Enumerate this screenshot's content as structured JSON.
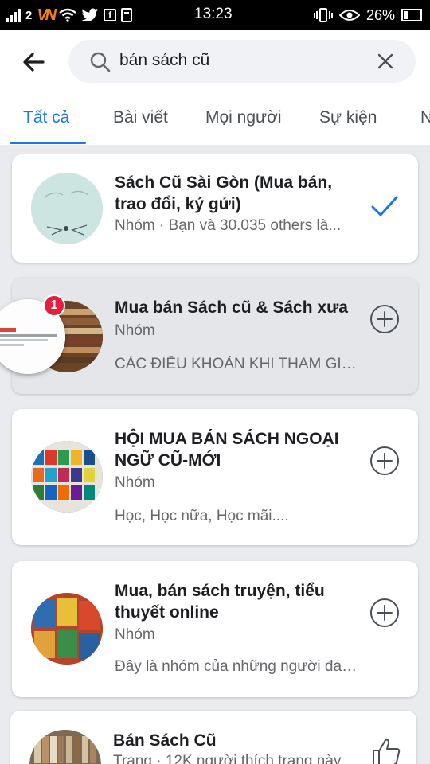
{
  "status_bar": {
    "carrier": "VN",
    "net_type": "2",
    "time": "13:23",
    "battery": "26%",
    "icons": [
      "signal-icon",
      "twitter-icon",
      "facebook-icon",
      "wifi-icon",
      "vibrate-icon",
      "eye-icon",
      "battery-icon"
    ]
  },
  "search": {
    "query": "bán sách cũ"
  },
  "tabs": [
    {
      "label": "Tất cả",
      "active": true
    },
    {
      "label": "Bài viết"
    },
    {
      "label": "Mọi người"
    },
    {
      "label": "Sự kiện"
    },
    {
      "label": "N"
    }
  ],
  "results": [
    {
      "title": "Sách Cũ Sài Gòn (Mua bán, trao đổi, ký gửi)",
      "subtitle": "Nhóm · Bạn và 30.035 others là...",
      "description": "",
      "action_icon": "checkmark-icon"
    },
    {
      "title": "Mua bán Sách cũ & Sách xưa",
      "subtitle": "Nhóm",
      "description": "CÁC ĐIỀU KHOẢN KHI THAM GIA...",
      "action_icon": "add-circle-icon"
    },
    {
      "title": "HỘI MUA BÁN SÁCH NGOẠI NGỮ CŨ-MỚI",
      "subtitle": "Nhóm",
      "description": "Học, Học nữa, Học mãi....",
      "action_icon": "add-circle-icon"
    },
    {
      "title": "Mua, bán sách truyện, tiểu thuyết online",
      "subtitle": "Nhóm",
      "description": "Đây là nhóm của những người đam mê...",
      "action_icon": "add-circle-icon"
    },
    {
      "title": "Bán Sách Cũ",
      "subtitle": "Trang · 12K người thích trang này",
      "description": "",
      "action_icon": "like-icon"
    }
  ],
  "chat_head": {
    "badge_count": "1"
  },
  "colors": {
    "accent": "#1877f2",
    "background": "#e9ebee",
    "badge": "#e41e3f"
  }
}
